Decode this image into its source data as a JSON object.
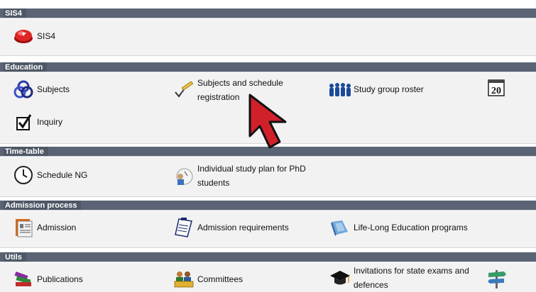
{
  "sections": [
    {
      "title": "SIS4",
      "items": [
        {
          "label": "SIS4",
          "icon": "red-button-icon"
        }
      ]
    },
    {
      "title": "Education",
      "items": [
        {
          "label": "Subjects",
          "icon": "blue-knot-icon"
        },
        {
          "label": "Subjects and schedule registration",
          "icon": "pencil-check-icon"
        },
        {
          "label": "Study group roster",
          "icon": "people-group-icon"
        },
        {
          "label": "",
          "icon": "calendar-icon"
        },
        {
          "label": "Inquiry",
          "icon": "checkbox-icon"
        }
      ]
    },
    {
      "title": "Time-table",
      "items": [
        {
          "label": "Schedule NG",
          "icon": "clock-icon"
        },
        {
          "label": "Individual study plan for PhD students",
          "icon": "study-plan-icon"
        }
      ]
    },
    {
      "title": "Admission process",
      "items": [
        {
          "label": "Admission",
          "icon": "admission-icon"
        },
        {
          "label": "Admission requirements",
          "icon": "clipboard-icon"
        },
        {
          "label": "Life-Long Education programs",
          "icon": "lifelong-education-icon"
        }
      ]
    },
    {
      "title": "Utils",
      "items": [
        {
          "label": "Publications",
          "icon": "books-icon"
        },
        {
          "label": "Committees",
          "icon": "committee-icon"
        },
        {
          "label": "Invitations for state exams and defences",
          "icon": "graduation-cap-icon"
        },
        {
          "label": "",
          "icon": "signpost-icon"
        }
      ]
    }
  ],
  "calendar_text": "20",
  "colors": {
    "section_header": "#5a6474",
    "section_body": "#f2f2f2",
    "cursor": "#d0202a"
  }
}
